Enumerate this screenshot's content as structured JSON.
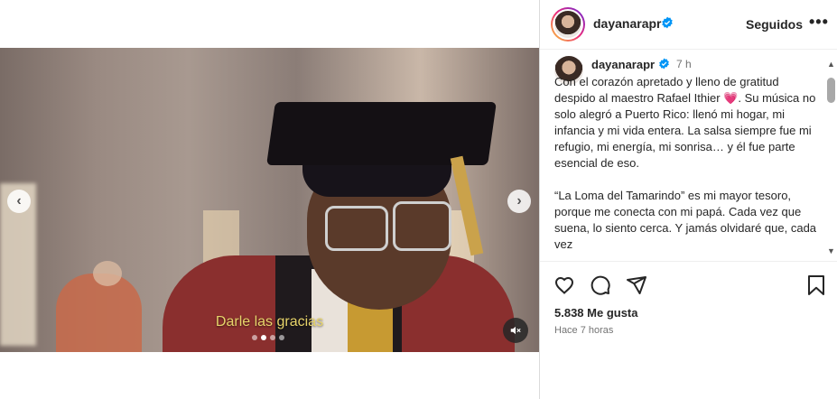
{
  "media": {
    "subtitle": "Darle las gracias",
    "slide_count": 4,
    "active_slide": 1,
    "prev_symbol": "‹",
    "next_symbol": "›",
    "muted": true
  },
  "header": {
    "username": "dayanarapr",
    "verified": true,
    "follow_state": "Seguidos",
    "more_symbol": "•••"
  },
  "caption": {
    "username": "dayanarapr",
    "time": "7 h",
    "text": "Con el corazón apretado y lleno de gratitud despido al maestro Rafael Ithier 💗. Su música no solo alegró a Puerto Rico: llenó mi hogar, mi infancia y mi vida entera. La salsa siempre fue mi refugio, mi energía, mi sonrisa… y él fue parte esencial de eso.\n\n“La Loma del Tamarindo” es mi mayor tesoro, porque me conecta con mi papá. Cada vez que suena, lo siento cerca. Y jamás olvidaré que, cada vez"
  },
  "footer": {
    "likes": "5.838 Me gusta",
    "time_ago": "Hace 7 horas"
  },
  "colors": {
    "verified_blue": "#0095f6",
    "subtitle_yellow": "#e7d46a"
  },
  "icons": [
    "heart-icon",
    "comment-icon",
    "share-icon",
    "bookmark-icon",
    "mute-icon",
    "verified-icon"
  ]
}
